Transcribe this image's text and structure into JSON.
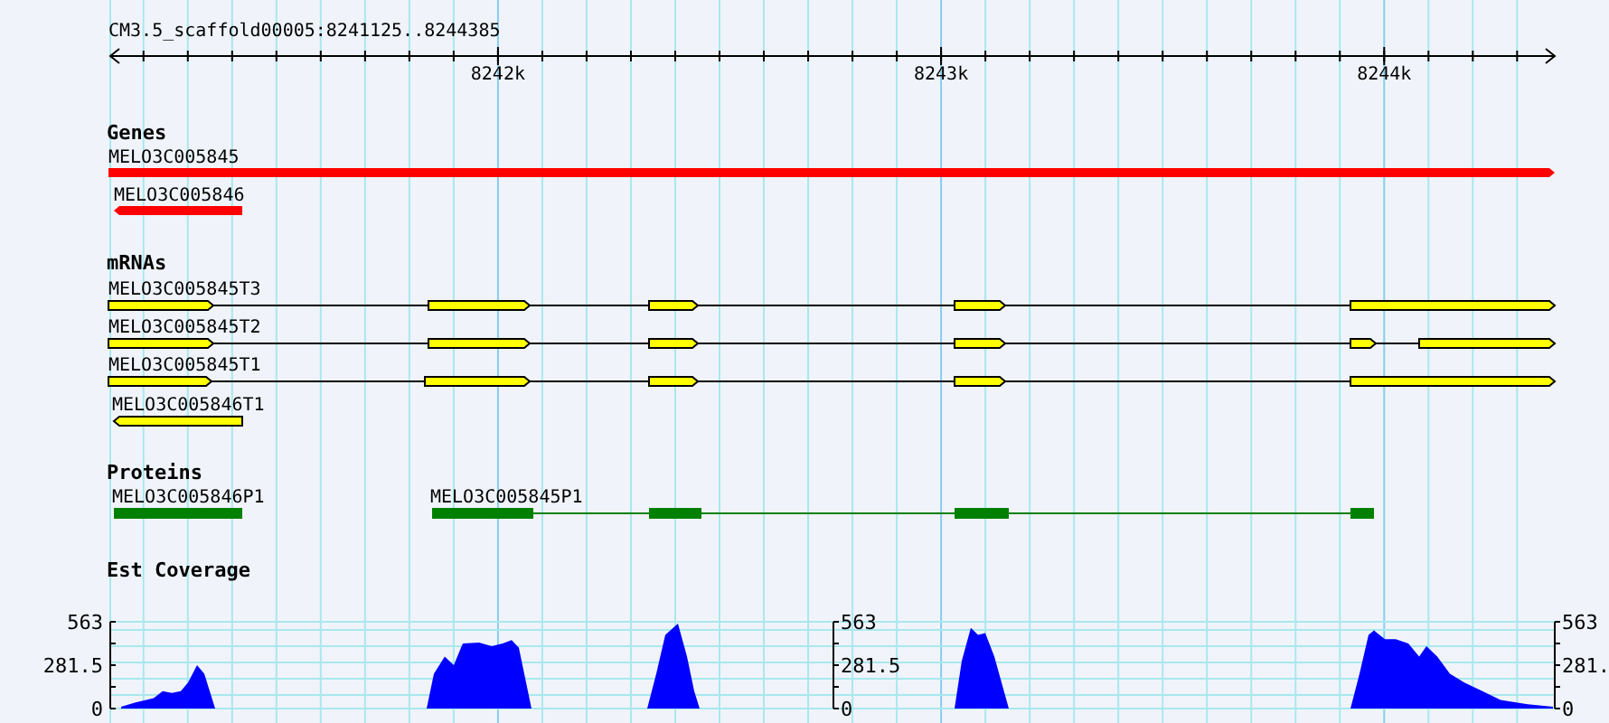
{
  "location": "CM3.5_scaffold00005:8241125..8244385",
  "ruler": {
    "ticks": [
      "8242k",
      "8243k",
      "8244k"
    ]
  },
  "tracks": [
    {
      "title": "Genes",
      "kind": "genes",
      "features": [
        {
          "name": "MELO3C005845"
        },
        {
          "name": "MELO3C005846"
        }
      ]
    },
    {
      "title": "mRNAs",
      "kind": "mrnas",
      "features": [
        {
          "name": "MELO3C005845T3"
        },
        {
          "name": "MELO3C005845T2"
        },
        {
          "name": "MELO3C005845T1"
        },
        {
          "name": "MELO3C005846T1"
        }
      ]
    },
    {
      "title": "Proteins",
      "kind": "proteins",
      "features": [
        {
          "name": "MELO3C005846P1"
        },
        {
          "name": "MELO3C005845P1"
        }
      ]
    },
    {
      "title": "Est Coverage",
      "kind": "coverage",
      "scales": [
        {
          "max": "563",
          "mid": "281.5",
          "min": "0"
        },
        {
          "max": "563",
          "mid": "281.5",
          "min": "0"
        },
        {
          "max": "563",
          "mid": "281.",
          "min": "0"
        }
      ]
    }
  ]
}
